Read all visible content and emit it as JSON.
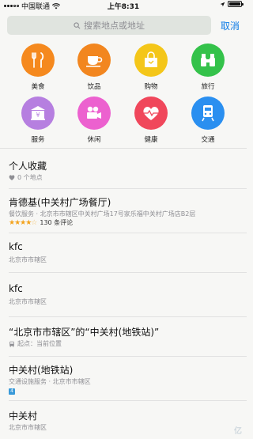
{
  "status_bar": {
    "carrier": "中国联通",
    "time": "上午8:31"
  },
  "search": {
    "placeholder": "搜索地点或地址",
    "cancel_label": "取消"
  },
  "categories": [
    {
      "label": "美食",
      "icon": "fork-knife-icon",
      "color": "#f5891e"
    },
    {
      "label": "饮品",
      "icon": "coffee-cup-icon",
      "color": "#f2861f"
    },
    {
      "label": "购物",
      "icon": "shopping-bag-icon",
      "color": "#f4c619"
    },
    {
      "label": "旅行",
      "icon": "binoculars-icon",
      "color": "#34c24a"
    },
    {
      "label": "服务",
      "icon": "bank-icon",
      "color": "#b67fe0"
    },
    {
      "label": "休闲",
      "icon": "film-camera-icon",
      "color": "#ec61cf"
    },
    {
      "label": "健康",
      "icon": "heart-icon",
      "color": "#f0475b"
    },
    {
      "label": "交通",
      "icon": "train-icon",
      "color": "#2a8ff0"
    }
  ],
  "favorites": {
    "title": "个人收藏",
    "subtitle": "0 个地点"
  },
  "results": [
    {
      "title": "肯德基(中关村广场餐厅)",
      "subtitle": "餐饮服务 · 北京市市辖区中关村广场17号家乐福中关村广场店B2层",
      "rating": 3.5,
      "reviews": "130 条评论"
    },
    {
      "title": "kfc",
      "subtitle": "北京市市辖区"
    },
    {
      "title": "kfc",
      "subtitle": "北京市市辖区"
    },
    {
      "title": "“北京市市辖区”的“中关村(地铁站)”",
      "subtitle": "起点：当前位置"
    },
    {
      "title": "中关村(地铁站)",
      "subtitle": "交通设施服务 · 北京市市辖区",
      "badge": "4"
    },
    {
      "title": "中关村",
      "subtitle": "北京市市辖区"
    }
  ],
  "watermark": "亿"
}
